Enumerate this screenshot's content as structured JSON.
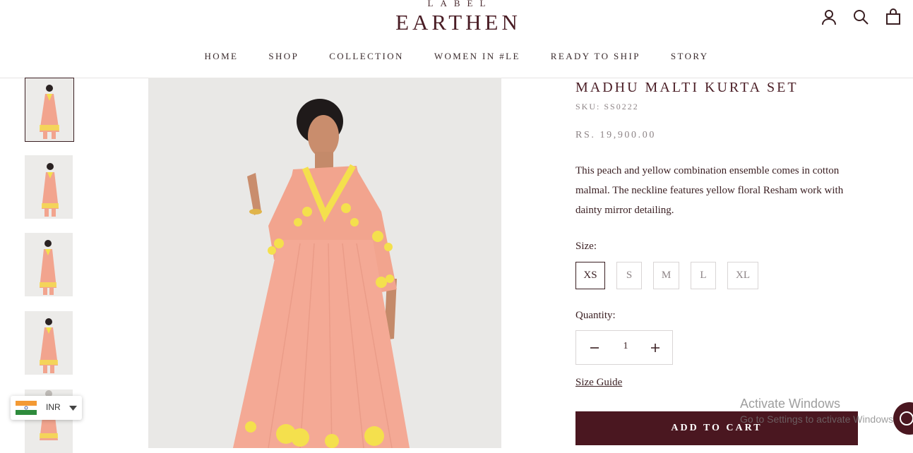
{
  "brand": {
    "small": "LABEL",
    "big": "EARTHEN"
  },
  "nav": [
    "HOME",
    "SHOP",
    "COLLECTION",
    "WOMEN IN #LE",
    "READY TO SHIP",
    "STORY"
  ],
  "product": {
    "title": "MADHU MALTI KURTA SET",
    "sku": "SKU: SS0222",
    "price": "RS. 19,900.00",
    "description": "This peach and yellow combination ensemble comes in cotton malmal. The neckline features yellow floral Resham work with dainty mirror detailing.",
    "size_label": "Size:",
    "sizes": [
      "XS",
      "S",
      "M",
      "L",
      "XL"
    ],
    "selected_size": "XS",
    "quantity_label": "Quantity:",
    "quantity": "1",
    "size_guide": "Size Guide",
    "add_to_cart": "ADD TO CART"
  },
  "currency": {
    "code": "INR",
    "flag": "india-flag-icon"
  },
  "watermark": {
    "line1": "Activate Windows",
    "line2": "Go to Settings to activate Windows."
  },
  "colors": {
    "brand": "#4a1720",
    "text": "#3a1f22",
    "muted": "#8d8486",
    "peach": "#f2a48e",
    "embroidery": "#f4e04d"
  }
}
